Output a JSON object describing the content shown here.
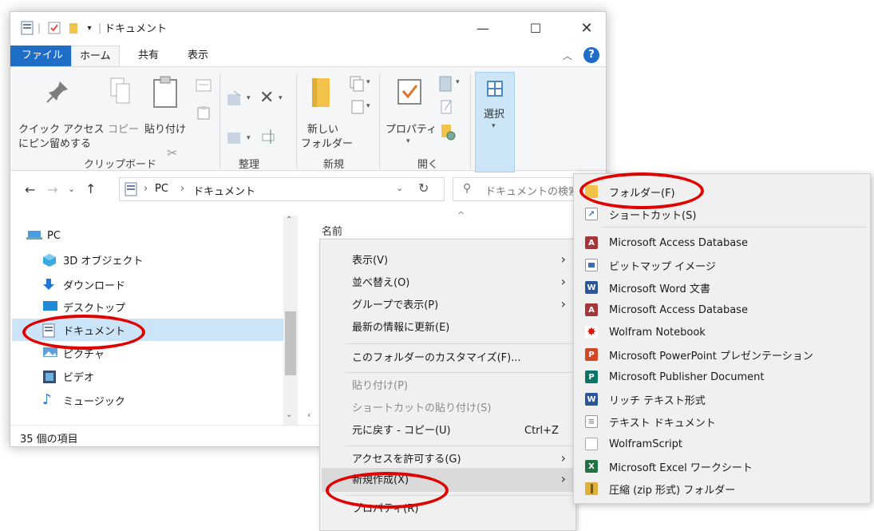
{
  "window": {
    "title": "ドキュメント",
    "tabs": [
      "ファイル",
      "ホーム",
      "共有",
      "表示"
    ]
  },
  "ribbon": {
    "pin_label_1": "クイック アクセス",
    "pin_label_2": "にピン留めする",
    "copy_label": "コピー",
    "paste_label": "貼り付け",
    "new_folder_label_1": "新しい",
    "new_folder_label_2": "フォルダー",
    "properties_label": "プロパティ",
    "select_label": "選択",
    "groups": [
      "クリップボード",
      "整理",
      "新規",
      "開く"
    ]
  },
  "address": {
    "path": [
      "PC",
      "ドキュメント"
    ],
    "search_placeholder": "ドキュメントの検索"
  },
  "nav": {
    "items": [
      "PC",
      "3D オブジェクト",
      "ダウンロード",
      "デスクトップ",
      "ドキュメント",
      "ピクチャ",
      "ビデオ",
      "ミュージック"
    ]
  },
  "list": {
    "column_name": "名前"
  },
  "status": {
    "count": "35 個の項目"
  },
  "context_menu": {
    "view": "表示(V)",
    "sort": "並べ替え(O)",
    "group": "グループで表示(P)",
    "refresh": "最新の情報に更新(E)",
    "customize": "このフォルダーのカスタマイズ(F)...",
    "paste": "貼り付け(P)",
    "paste_shortcut": "ショートカットの貼り付け(S)",
    "undo": "元に戻す - コピー(U)",
    "undo_shortcut": "Ctrl+Z",
    "access": "アクセスを許可する(G)",
    "new": "新規作成(X)",
    "properties": "プロパティ(R)"
  },
  "submenu": {
    "items": [
      {
        "label": "フォルダー(F)",
        "icon": "folder-icon",
        "color": "#f2c24b"
      },
      {
        "label": "ショートカット(S)",
        "icon": "shortcut-icon",
        "color": "#1f6fd1"
      },
      {
        "label": "Microsoft Access Database",
        "icon": "access-icon",
        "color": "#a4373a"
      },
      {
        "label": "ビットマップ イメージ",
        "icon": "bitmap-icon",
        "color": "#3a6fb7"
      },
      {
        "label": "Microsoft Word 文書",
        "icon": "word-icon",
        "color": "#2b579a"
      },
      {
        "label": "Microsoft Access Database",
        "icon": "access-icon",
        "color": "#a4373a"
      },
      {
        "label": "Wolfram Notebook",
        "icon": "wolfram-icon",
        "color": "#dd1100"
      },
      {
        "label": "Microsoft PowerPoint プレゼンテーション",
        "icon": "powerpoint-icon",
        "color": "#d24726"
      },
      {
        "label": "Microsoft Publisher Document",
        "icon": "publisher-icon",
        "color": "#077568"
      },
      {
        "label": "リッチ テキスト形式",
        "icon": "rtf-icon",
        "color": "#2b579a"
      },
      {
        "label": "テキスト ドキュメント",
        "icon": "text-doc-icon",
        "color": "#888888"
      },
      {
        "label": "WolframScript",
        "icon": "blank-doc-icon",
        "color": "#aaaaaa"
      },
      {
        "label": "Microsoft Excel ワークシート",
        "icon": "excel-icon",
        "color": "#217346"
      },
      {
        "label": "圧縮 (zip 形式) フォルダー",
        "icon": "zip-folder-icon",
        "color": "#e0b03a"
      }
    ]
  },
  "colors": {
    "accent": "#1e6ec8",
    "annotation": "#e00000",
    "selection": "#cce4f7"
  }
}
